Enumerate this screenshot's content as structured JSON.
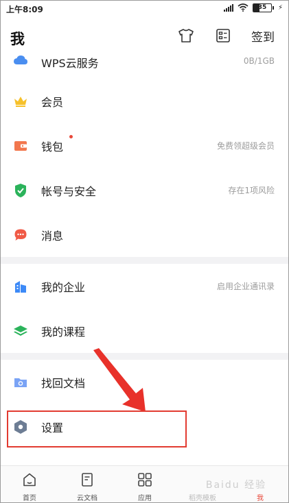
{
  "status_bar": {
    "time": "上午8:09",
    "battery": "35"
  },
  "header": {
    "title": "我",
    "signin_label": "签到"
  },
  "menu": {
    "cloud_service": {
      "label": "WPS云服务",
      "value": "0B/1GB"
    },
    "member": {
      "label": "会员"
    },
    "wallet": {
      "label": "钱包",
      "value": "免费领超级会员"
    },
    "account_security": {
      "label": "帐号与安全",
      "value": "存在1项风险"
    },
    "messages": {
      "label": "消息"
    },
    "my_enterprise": {
      "label": "我的企业",
      "value": "启用企业通讯录"
    },
    "my_courses": {
      "label": "我的课程"
    },
    "recover_docs": {
      "label": "找回文档"
    },
    "settings": {
      "label": "设置"
    }
  },
  "bottom_nav": {
    "items": [
      {
        "label": "首页"
      },
      {
        "label": "云文档"
      },
      {
        "label": "应用"
      },
      {
        "label": "稻壳模板"
      },
      {
        "label": "我"
      }
    ]
  },
  "colors": {
    "accent": "#e8483a",
    "highlight_box": "#e23a30",
    "text": "#222222",
    "secondary_text": "#9c9c9c"
  },
  "watermark": {
    "text": "Baidu 经验"
  }
}
